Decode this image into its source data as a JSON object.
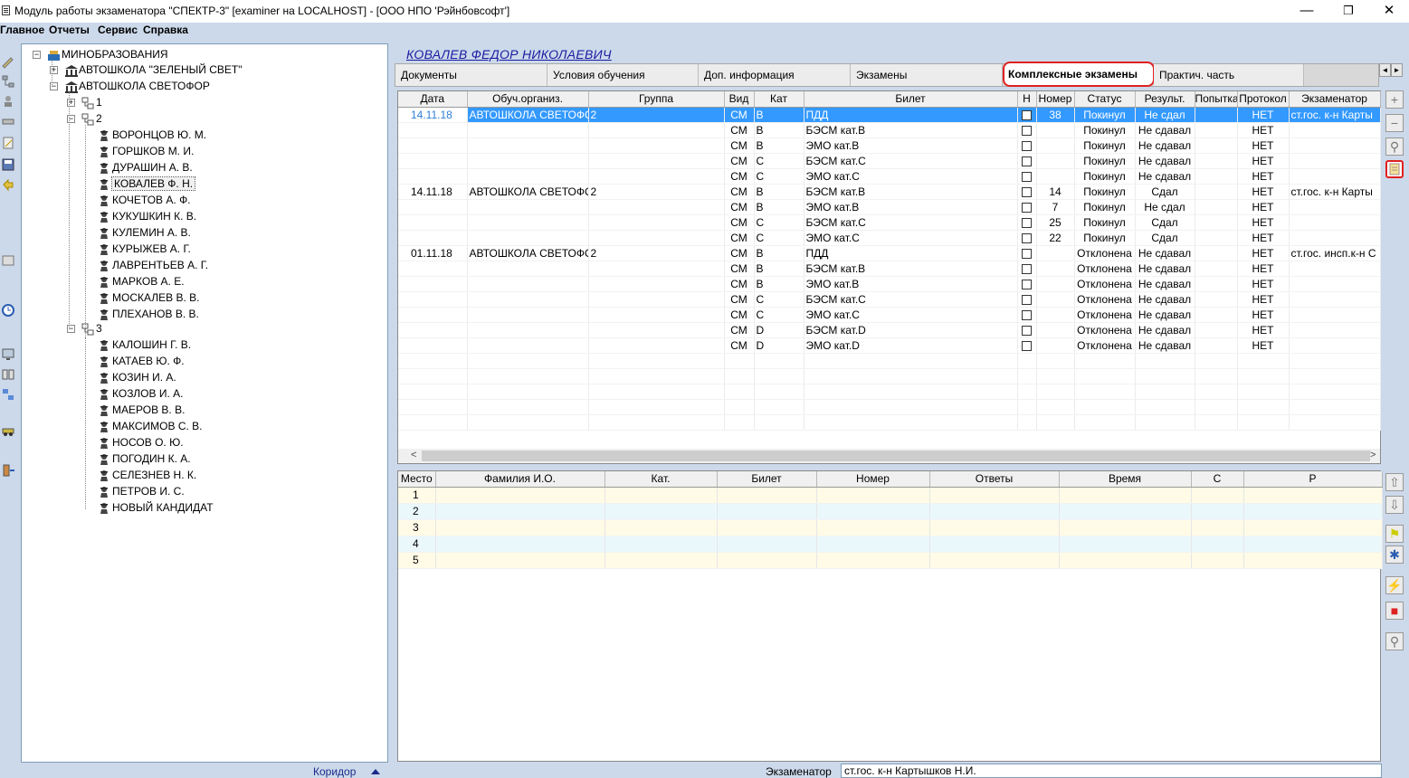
{
  "window": {
    "title": "Модуль работы экзаменатора \"СПЕКТР-3\" [examiner на LOCALHOST] - [ООО НПО 'Рэйнбовсофт']",
    "controls": {
      "minimize": "—",
      "restore": "❐",
      "close": "✕"
    }
  },
  "menu": [
    "Главное",
    "Отчеты",
    "Сервис",
    "Справка"
  ],
  "tree": {
    "root": "МИНОБРАЗОВАНИЯ",
    "schools": [
      "АВТОШКОЛА \"ЗЕЛЕНЫЙ СВЕТ\"",
      "АВТОШКОЛА СВЕТОФОР"
    ],
    "groups": [
      "1",
      "2",
      "3"
    ],
    "group2_students": [
      "ВОРОНЦОВ Ю. М.",
      "ГОРШКОВ М. И.",
      "ДУРАШИН А. В.",
      "КОВАЛЕВ Ф. Н.",
      "КОЧЕТОВ А. Ф.",
      "КУКУШКИН К. В.",
      "КУЛЕМИН А. В.",
      "КУРЫЖЕВ А. Г.",
      "ЛАВРЕНТЬЕВ А. Г.",
      "МАРКОВ А. Е.",
      "МОСКАЛЕВ В. В.",
      "ПЛЕХАНОВ В. В."
    ],
    "group3_students": [
      "КАЛОШИН Г. В.",
      "КАТАЕВ Ю. Ф.",
      "КОЗИН И. А.",
      "КОЗЛОВ И. А.",
      "МАЕРОВ В. В.",
      "МАКСИМОВ С. В.",
      "НОСОВ О. Ю.",
      "ПОГОДИН К. А.",
      "СЕЛЕЗНЕВ Н. К.",
      "ПЕТРОВ И. С.",
      "НОВЫЙ КАНДИДАТ"
    ],
    "selected": "КОВАЛЕВ Ф. Н.",
    "footer": "Коридор"
  },
  "student": {
    "name": "КОВАЛЕВ ФЕДОР НИКОЛАЕВИЧ"
  },
  "tabs": [
    {
      "label": "Документы"
    },
    {
      "label": "Условия обучения"
    },
    {
      "label": "Доп. информация"
    },
    {
      "label": "Экзамены"
    },
    {
      "label": "Комплексные экзамены",
      "active": true
    },
    {
      "label": "Практич. часть"
    }
  ],
  "exams_table": {
    "columns": [
      "Дата",
      "Обуч.организ.",
      "Группа",
      "Вид",
      "Кат",
      "Билет",
      "Н",
      "Номер",
      "Статус",
      "Результ.",
      "Попытка",
      "Протокол",
      "Экзаменатор"
    ],
    "rows": [
      [
        "14.11.18",
        "АВТОШКОЛА СВЕТОФО",
        "2",
        "СМ",
        "B",
        "ПДД",
        "",
        "38",
        "Покинул",
        "Не сдал",
        "",
        "НЕТ",
        "ст.гос. к-н Карты"
      ],
      [
        "",
        "",
        "",
        "СМ",
        "B",
        "БЭСМ кат.B",
        "",
        "",
        "Покинул",
        "Не сдавал",
        "",
        "НЕТ",
        ""
      ],
      [
        "",
        "",
        "",
        "СМ",
        "B",
        "ЭМО кат.B",
        "",
        "",
        "Покинул",
        "Не сдавал",
        "",
        "НЕТ",
        ""
      ],
      [
        "",
        "",
        "",
        "СМ",
        "C",
        "БЭСМ кат.C",
        "",
        "",
        "Покинул",
        "Не сдавал",
        "",
        "НЕТ",
        ""
      ],
      [
        "",
        "",
        "",
        "СМ",
        "C",
        "ЭМО кат.C",
        "",
        "",
        "Покинул",
        "Не сдавал",
        "",
        "НЕТ",
        ""
      ],
      [
        "14.11.18",
        "АВТОШКОЛА СВЕТОФО",
        "2",
        "СМ",
        "B",
        "БЭСМ кат.B",
        "",
        "14",
        "Покинул",
        "Сдал",
        "",
        "НЕТ",
        "ст.гос. к-н Карты"
      ],
      [
        "",
        "",
        "",
        "СМ",
        "B",
        "ЭМО кат.B",
        "",
        "7",
        "Покинул",
        "Не сдал",
        "",
        "НЕТ",
        ""
      ],
      [
        "",
        "",
        "",
        "СМ",
        "C",
        "БЭСМ кат.C",
        "",
        "25",
        "Покинул",
        "Сдал",
        "",
        "НЕТ",
        ""
      ],
      [
        "",
        "",
        "",
        "СМ",
        "C",
        "ЭМО кат.C",
        "",
        "22",
        "Покинул",
        "Сдал",
        "",
        "НЕТ",
        ""
      ],
      [
        "01.11.18",
        "АВТОШКОЛА СВЕТОФО",
        "2",
        "СМ",
        "B",
        "ПДД",
        "",
        "",
        "Отклонена",
        "Не сдавал",
        "",
        "НЕТ",
        "ст.гос. инсп.к-н  С"
      ],
      [
        "",
        "",
        "",
        "СМ",
        "B",
        "БЭСМ кат.B",
        "",
        "",
        "Отклонена",
        "Не сдавал",
        "",
        "НЕТ",
        ""
      ],
      [
        "",
        "",
        "",
        "СМ",
        "B",
        "ЭМО кат.B",
        "",
        "",
        "Отклонена",
        "Не сдавал",
        "",
        "НЕТ",
        ""
      ],
      [
        "",
        "",
        "",
        "СМ",
        "C",
        "БЭСМ кат.C",
        "",
        "",
        "Отклонена",
        "Не сдавал",
        "",
        "НЕТ",
        ""
      ],
      [
        "",
        "",
        "",
        "СМ",
        "C",
        "ЭМО кат.C",
        "",
        "",
        "Отклонена",
        "Не сдавал",
        "",
        "НЕТ",
        ""
      ],
      [
        "",
        "",
        "",
        "СМ",
        "D",
        "БЭСМ кат.D",
        "",
        "",
        "Отклонена",
        "Не сдавал",
        "",
        "НЕТ",
        ""
      ],
      [
        "",
        "",
        "",
        "СМ",
        "D",
        "ЭМО кат.D",
        "",
        "",
        "Отклонена",
        "Не сдавал",
        "",
        "НЕТ",
        ""
      ]
    ]
  },
  "places_table": {
    "columns": [
      "Место",
      "Фамилия И.О.",
      "Кат.",
      "Билет",
      "Номер",
      "Ответы",
      "Время",
      "С",
      "Р"
    ],
    "rows": [
      "1",
      "2",
      "3",
      "4",
      "5"
    ]
  },
  "status": {
    "examiner_label": "Экзаменатор",
    "examiner_value": "ст.гос. к-н Картышков Н.И."
  },
  "colors": {
    "selection": "#3399ff",
    "highlight_border": "#e02020",
    "name_link": "#1a1aa0",
    "background": "#ccd9ea"
  }
}
